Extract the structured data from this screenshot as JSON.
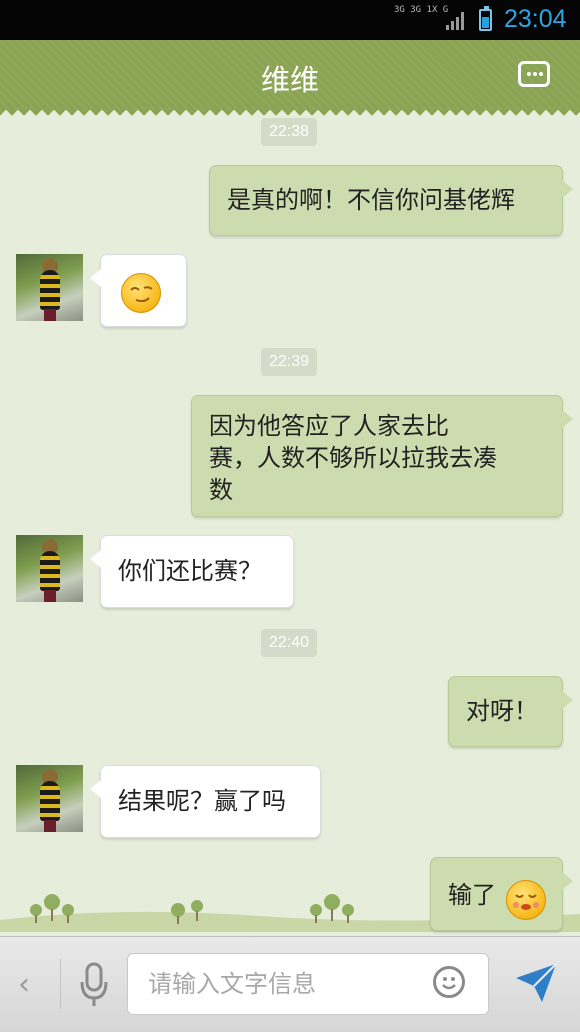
{
  "status_bar": {
    "network_labels": [
      "3G",
      "3G 1X",
      "G"
    ],
    "time": "23:04",
    "battery_level": 0.7,
    "accent_color": "#2aa7e3"
  },
  "header": {
    "title": "维维",
    "menu_icon": "more-dots-icon",
    "color": "#8aa453"
  },
  "timestamps": [
    "22:38",
    "22:39",
    "22:40"
  ],
  "messages": [
    {
      "direction": "outgoing",
      "text": "是真的啊！不信你问基佬辉"
    },
    {
      "direction": "incoming",
      "text": "",
      "emoji": "sly-smile-emoji"
    },
    {
      "direction": "outgoing",
      "lines": [
        "因为他答应了人家去比",
        "赛，人数不够所以拉我去凑",
        "数"
      ]
    },
    {
      "direction": "incoming",
      "text": "你们还比赛？"
    },
    {
      "direction": "outgoing",
      "text": "对呀！"
    },
    {
      "direction": "incoming",
      "text": "结果呢？赢了吗"
    },
    {
      "direction": "outgoing",
      "text": "输了",
      "emoji": "embarrassed-emoji"
    }
  ],
  "input_bar": {
    "back_icon": "chevron-left-icon",
    "voice_icon": "microphone-icon",
    "placeholder": "请输入文字信息",
    "emoji_icon": "smiley-icon",
    "send_icon": "send-icon"
  }
}
